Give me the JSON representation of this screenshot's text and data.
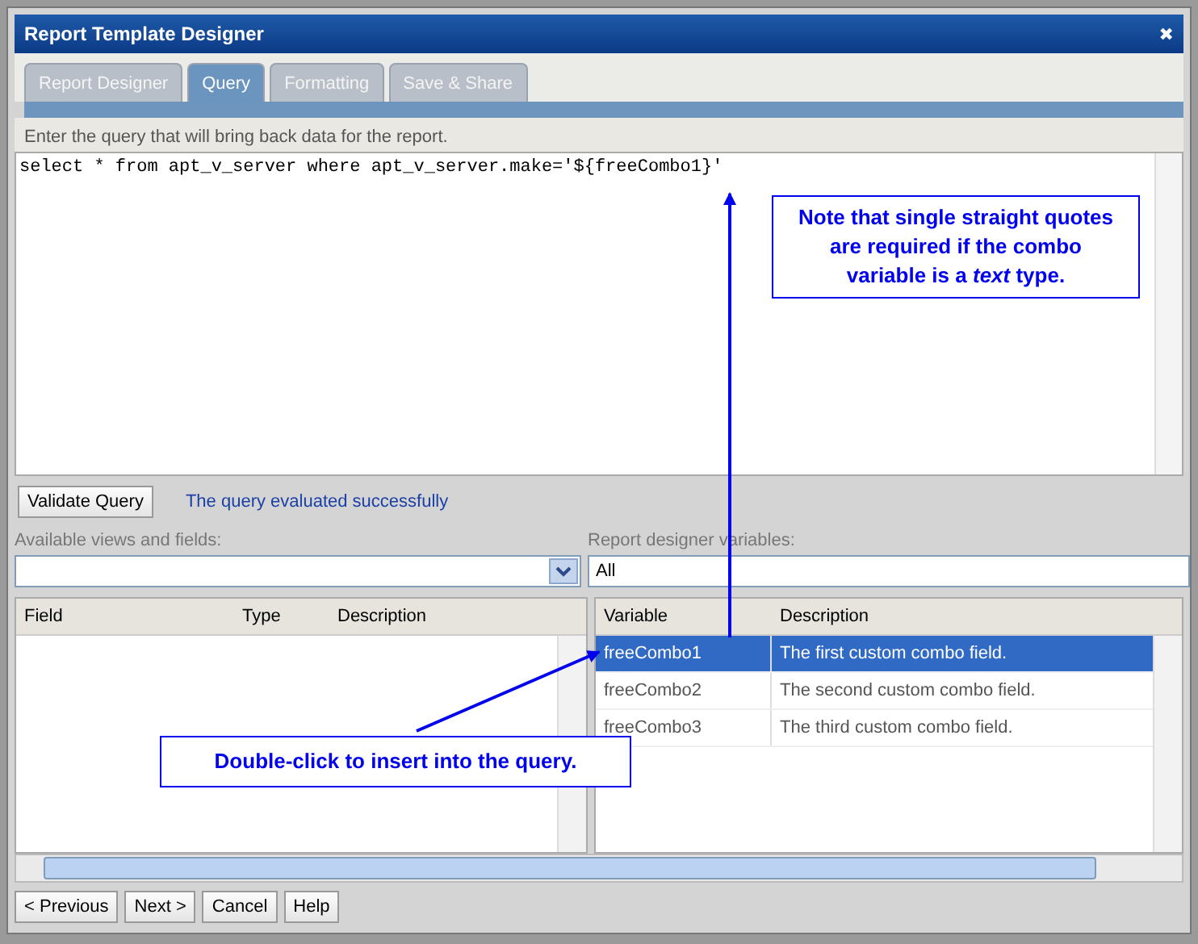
{
  "window": {
    "title": "Report Template Designer",
    "close": "✖"
  },
  "tabs": [
    {
      "label": "Report Designer",
      "selected": false
    },
    {
      "label": "Query",
      "selected": true
    },
    {
      "label": "Formatting",
      "selected": false
    },
    {
      "label": "Save & Share",
      "selected": false
    }
  ],
  "instruction": "Enter the query that will bring back data for the report.",
  "query": "select * from apt_v_server where apt_v_server.make='${freeCombo1}'",
  "validate_button": "Validate Query",
  "status": "The query evaluated successfully",
  "fields_label": "Available views and fields:",
  "variables_label": "Report designer variables:",
  "variables_filter": "All",
  "fields_table": {
    "columns": [
      "Field",
      "Type",
      "Description"
    ]
  },
  "variables_table": {
    "columns": [
      "Variable",
      "Description"
    ],
    "rows": [
      {
        "variable": "freeCombo1",
        "description": "The first custom combo field.",
        "selected": true
      },
      {
        "variable": "freeCombo2",
        "description": "The second custom combo field.",
        "selected": false
      },
      {
        "variable": "freeCombo3",
        "description": "The third custom combo field.",
        "selected": false
      }
    ]
  },
  "buttons": [
    "< Previous",
    "Next >",
    "Cancel",
    "Help"
  ],
  "callouts": [
    {
      "text": "Note that single straight quotes are required if the combo variable is a *text* type."
    },
    {
      "text": "Double-click to insert into the query."
    }
  ]
}
